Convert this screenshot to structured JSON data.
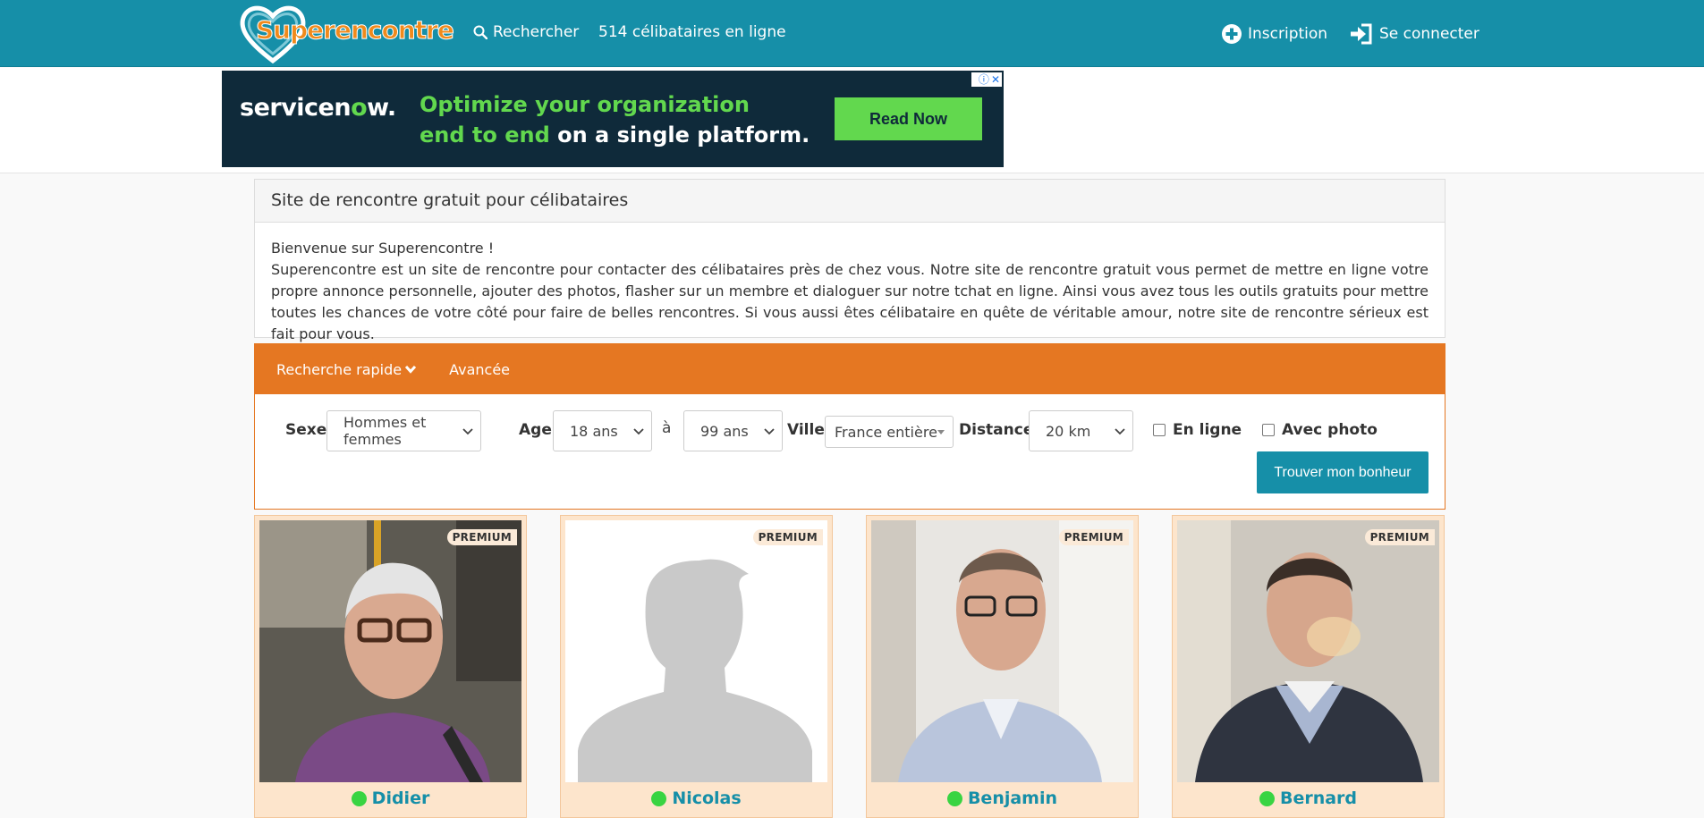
{
  "header": {
    "logo_text_1": "Super",
    "logo_text_2": "encontre",
    "search_label": "Rechercher",
    "online_label": "514 célibataires en ligne",
    "signup_label": "Inscription",
    "login_label": "Se connecter"
  },
  "ad": {
    "brand_1": "servicen",
    "brand_o": "o",
    "brand_2": "w.",
    "line1": "Optimize your organization",
    "line2_green": "end to end",
    "line2_white": " on a single platform.",
    "cta": "Read Now"
  },
  "welcome": {
    "title": "Site de rencontre gratuit pour célibataires",
    "greeting": "Bienvenue sur Superencontre !",
    "body": "Superencontre est un site de rencontre pour contacter des célibataires près de chez vous. Notre site de rencontre gratuit vous permet de mettre en ligne votre propre annonce personnelle, ajouter des photos, flasher sur un membre et dialoguer sur notre tchat en ligne. Ainsi vous avez tous les outils gratuits pour mettre toutes les chances de votre côté pour faire de belles rencontres. Si vous aussi êtes célibataire en quête de véritable amour, notre site de rencontre sérieux est fait pour vous."
  },
  "search": {
    "tab_quick": "Recherche rapide",
    "tab_advanced": "Avancée",
    "sex_label": "Sexe",
    "sex_value": "Hommes et femmes",
    "age_label": "Age",
    "age_from": "18 ans",
    "age_to_word": "à",
    "age_to": "99 ans",
    "city_label": "Ville",
    "city_value": "France entière",
    "distance_label": "Distance",
    "distance_value": "20 km",
    "online_label": "En ligne",
    "photo_label": "Avec photo",
    "submit": "Trouver mon bonheur"
  },
  "profiles": [
    {
      "name": "Didier",
      "badge": "PREMIUM",
      "online": true
    },
    {
      "name": "Nicolas",
      "badge": "PREMIUM",
      "online": true
    },
    {
      "name": "Benjamin",
      "badge": "PREMIUM",
      "online": true
    },
    {
      "name": "Bernard",
      "badge": "PREMIUM",
      "online": true
    }
  ],
  "colors": {
    "brand_teal": "#168fa8",
    "search_orange": "#e57722",
    "card_bg": "#fde5cc",
    "online_green": "#39d442",
    "ad_green": "#62d84e"
  }
}
